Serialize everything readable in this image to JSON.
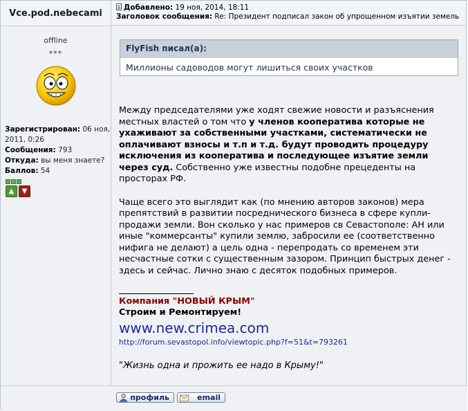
{
  "author": {
    "name": "Vce.pod.nebecami",
    "status": "offline",
    "rank_stars": "***",
    "registered_label": "Зарегистрирован:",
    "registered_value": "06 ноя, 2011, 0:26",
    "messages_label": "Сообщения:",
    "messages_value": "793",
    "from_label": "Откуда:",
    "from_value": "вы меня знаете?",
    "points_label": "Баллов:",
    "points_value": "54",
    "icons": [
      "smiley-avatar-icon",
      "thumb-up-icon",
      "thumb-down-icon"
    ]
  },
  "header": {
    "added_label": "Добавлено:",
    "added_value": "19 ноя, 2014, 18:11",
    "subject_label": "Заголовок сообщения:",
    "subject_value": "Re: Президент подписал закон об упрощенном изъятии земель"
  },
  "quote": {
    "author": "FlyFish писал(а):",
    "text": "Миллионы садоводов могут лишиться своих участков"
  },
  "body": {
    "p1_a": "Между председателями уже ходят свежие новости и разъяснения местных властей о том что ",
    "p1_bold": "у членов кооператива которые не ухаживают за собственными участками, систематически не оплачивают взносы и т.п и т.д. будут проводить процедуру исключения из кооператива и последующее изъятие земли через суд.",
    "p1_b": " Собственно уже известны подобне прецеденты на просторах РФ.",
    "p2": "Чаще всего это выглядит как (по мнению авторов законов) мера препятствий в развитии посреднического бизнеса в сфере купли-продажи земли. Вон сколько у нас примеров св Севастополе: АН или иные \"коммерсанты\" купили землю, забросили ее (соответственно нифига не делают) а цель одна - перепродать со временем эти несчастные сотки с существенным зазором. Принцип быстрых денег - здесь и сейчас. Лично знаю с десяток подобных примеров."
  },
  "signature": {
    "company": "Компания \"НОВЫЙ КРЫМ\"",
    "slogan": "Строим и Ремонтируем!",
    "site": "www.new.crimea.com",
    "link": "http://forum.sevastopol.info/viewtopic.php?f=51&t=793261",
    "quote": "\"Жизнь одна и прожить ее надо в Крыму!\""
  },
  "footer": {
    "profile_label": "профиль",
    "email_label": "email"
  },
  "colors": {
    "quote_header": "#c8d0da",
    "company_red": "#8b0000",
    "link_blue": "#1a2a9a"
  }
}
